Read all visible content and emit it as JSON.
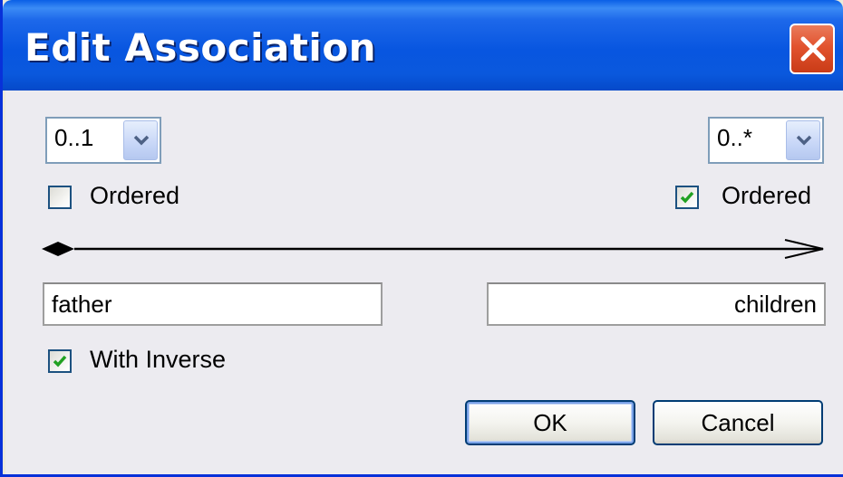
{
  "window": {
    "title": "Edit Association",
    "close_icon": "close-icon"
  },
  "left_end": {
    "multiplicity": "0..1",
    "ordered_label": "Ordered",
    "ordered_checked": false,
    "role_name": "father"
  },
  "right_end": {
    "multiplicity": "0..*",
    "ordered_label": "Ordered",
    "ordered_checked": true,
    "role_name": "children"
  },
  "association": {
    "source_marker": "filled-diamond",
    "target_marker": "open-arrow"
  },
  "options": {
    "with_inverse_label": "With Inverse",
    "with_inverse_checked": true
  },
  "buttons": {
    "ok_label": "OK",
    "cancel_label": "Cancel"
  },
  "colors": {
    "titlebar": "#0a58dd",
    "checkmark": "#21a121",
    "close_button": "#e2532e"
  }
}
